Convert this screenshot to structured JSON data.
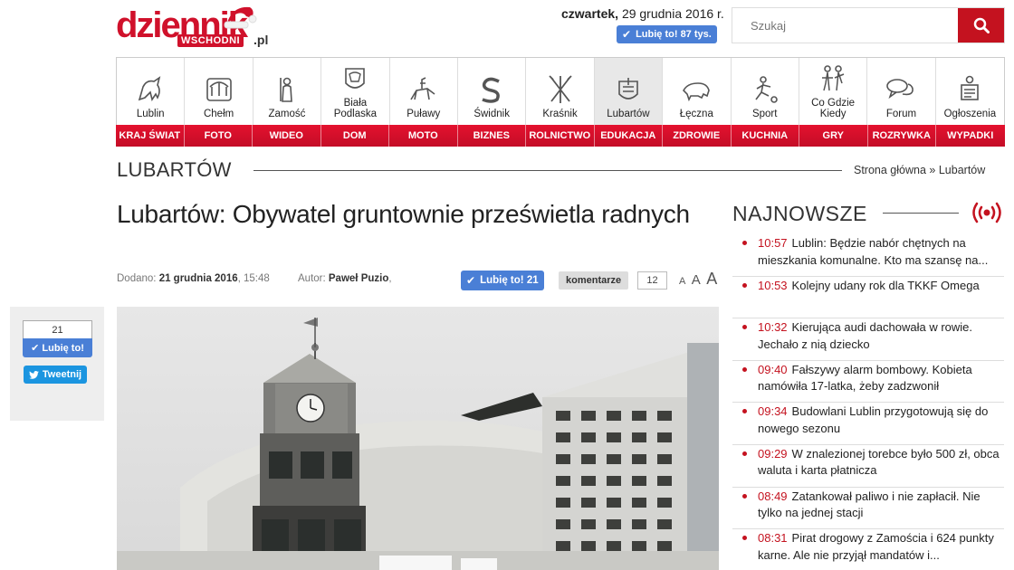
{
  "header": {
    "logo_main": "dziennik",
    "logo_sub": "WSCHODNI",
    "logo_domain": ".pl",
    "date_weekday": "czwartek,",
    "date_rest": "29 grudnia 2016 r.",
    "fb_like_label": "Lubię to!",
    "fb_like_count": "87 tys.",
    "search_placeholder": "Szukaj"
  },
  "nav": {
    "cities": [
      {
        "label": "Lublin",
        "icon": "goat-crest-icon"
      },
      {
        "label": "Chełm",
        "icon": "bear-tree-crest-icon"
      },
      {
        "label": "Zamość",
        "icon": "saint-crest-icon"
      },
      {
        "label": "Biała Podlaska",
        "icon": "eagle-crest-icon"
      },
      {
        "label": "Puławy",
        "icon": "rider-crest-icon"
      },
      {
        "label": "Świdnik",
        "icon": "s-crest-icon"
      },
      {
        "label": "Kraśnik",
        "icon": "arrows-crest-icon"
      },
      {
        "label": "Lubartów",
        "icon": "lubartow-crest-icon",
        "active": true
      },
      {
        "label": "Łęczna",
        "icon": "boar-crest-icon"
      },
      {
        "label": "Sport",
        "icon": "football-icon"
      },
      {
        "label": "Co Gdzie Kiedy",
        "icon": "people-icon"
      },
      {
        "label": "Forum",
        "icon": "speech-bubbles-icon"
      },
      {
        "label": "Ogłoszenia",
        "icon": "notice-icon"
      }
    ],
    "categories": [
      "KRAJ ŚWIAT",
      "FOTO",
      "WIDEO",
      "DOM",
      "MOTO",
      "BIZNES",
      "ROLNICTWO",
      "EDUKACJA",
      "ZDROWIE",
      "KUCHNIA",
      "GRY",
      "ROZRYWKA",
      "WYPADKI"
    ]
  },
  "section": {
    "title": "LUBARTÓW",
    "breadcrumb_home": "Strona główna",
    "breadcrumb_sep": "»",
    "breadcrumb_current": "Lubartów"
  },
  "article": {
    "headline": "Lubartów: Obywatel gruntownie prześwietla radnych",
    "added_label": "Dodano:",
    "added_date": "21 grudnia 2016",
    "added_time": ", 15:48",
    "author_label": "Autor:",
    "author_name": "Paweł Puzio",
    "author_suffix": ",",
    "fb_like_label": "Lubię to!",
    "fb_like_count": "21",
    "comments_label": "komentarze",
    "comments_count": "12",
    "font_small": "A",
    "font_medium": "A",
    "font_large": "A"
  },
  "share": {
    "like_count": "21",
    "like_label": "Lubię to!",
    "tweet_label": "Tweetnij"
  },
  "latest": {
    "title": "NAJNOWSZE",
    "items": [
      {
        "time": "10:57",
        "text": "Lublin: Będzie nabór chętnych na mieszkania komunalne. Kto ma szansę na..."
      },
      {
        "time": "10:53",
        "text": "Kolejny udany rok dla TKKF Omega"
      },
      {
        "time": "10:32",
        "text": "Kierująca audi dachowała w rowie. Jechało z nią dziecko"
      },
      {
        "time": "09:40",
        "text": "Fałszywy alarm bombowy. Kobieta namówiła 17-latka, żeby zadzwonił"
      },
      {
        "time": "09:34",
        "text": "Budowlani Lublin przygotowują się do nowego sezonu"
      },
      {
        "time": "09:29",
        "text": "W znalezionej torebce było 500 zł, obca waluta i karta płatnicza"
      },
      {
        "time": "08:49",
        "text": "Zatankował paliwo i nie zapłacił. Nie tylko na jednej stacji"
      },
      {
        "time": "08:31",
        "text": "Pirat drogowy z Zamościa i 624 punkty karne. Ale nie przyjął mandatów i..."
      }
    ]
  },
  "colors": {
    "brand_red": "#c4121f",
    "facebook_blue": "#4a7fd6",
    "twitter_blue": "#1b95e0"
  }
}
